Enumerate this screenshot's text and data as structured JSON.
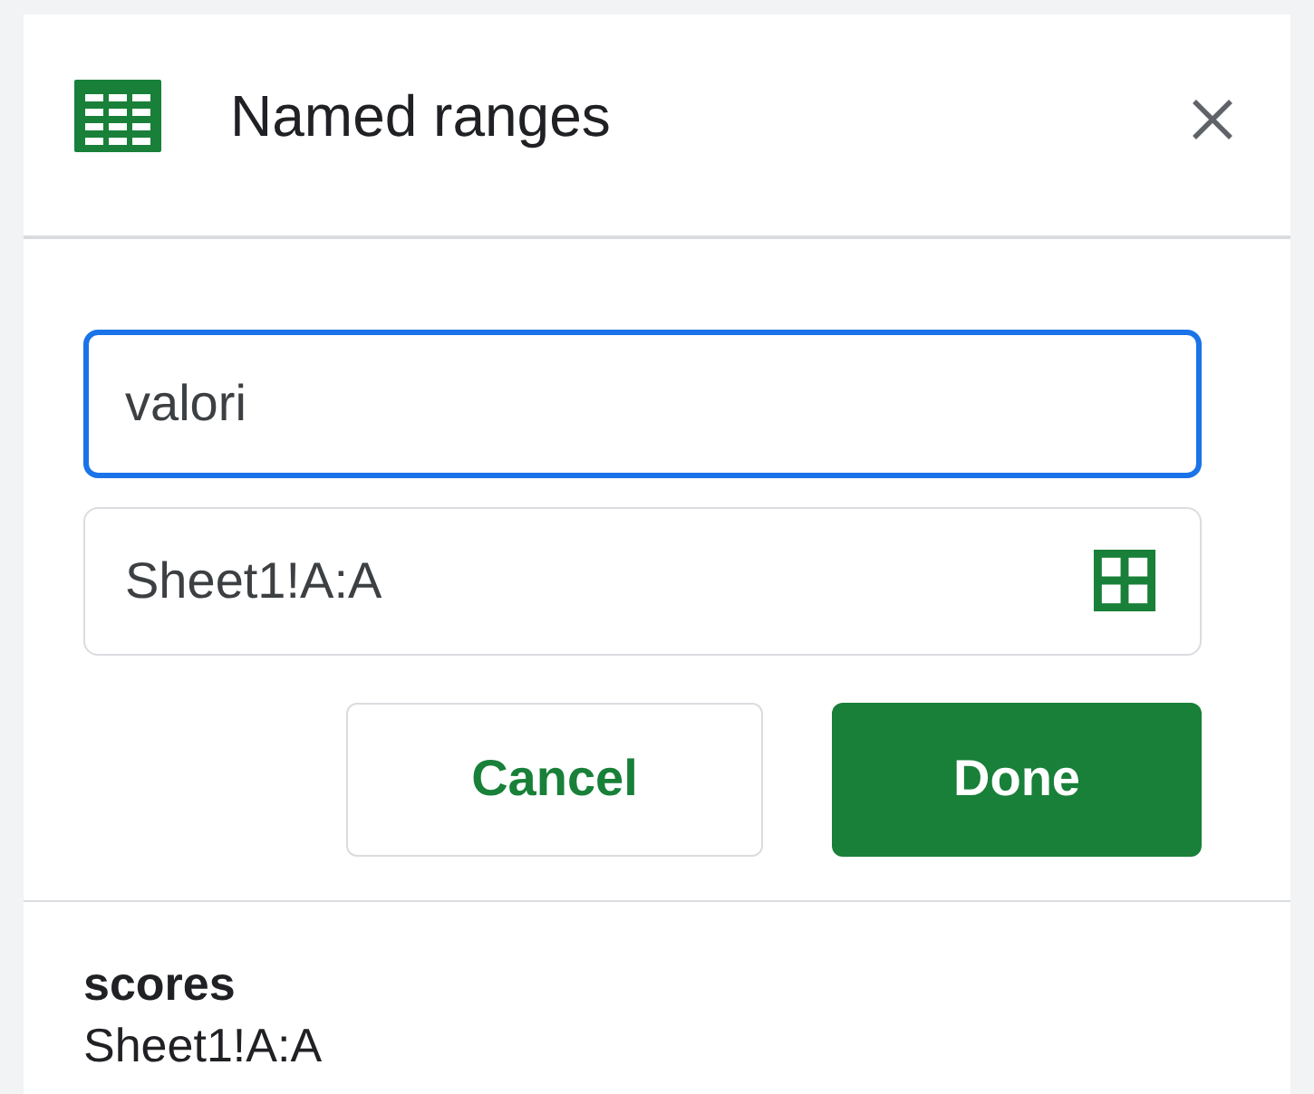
{
  "panel": {
    "title": "Named ranges"
  },
  "name_field": {
    "value": "valori",
    "focused": true
  },
  "range_field": {
    "value": "Sheet1!A:A",
    "focused": false
  },
  "buttons": [
    {
      "label": "Cancel",
      "kind": "secondary"
    },
    {
      "label": "Done",
      "kind": "primary"
    }
  ],
  "ranges": [
    {
      "name": "scores",
      "range": "Sheet1!A:A"
    }
  ]
}
